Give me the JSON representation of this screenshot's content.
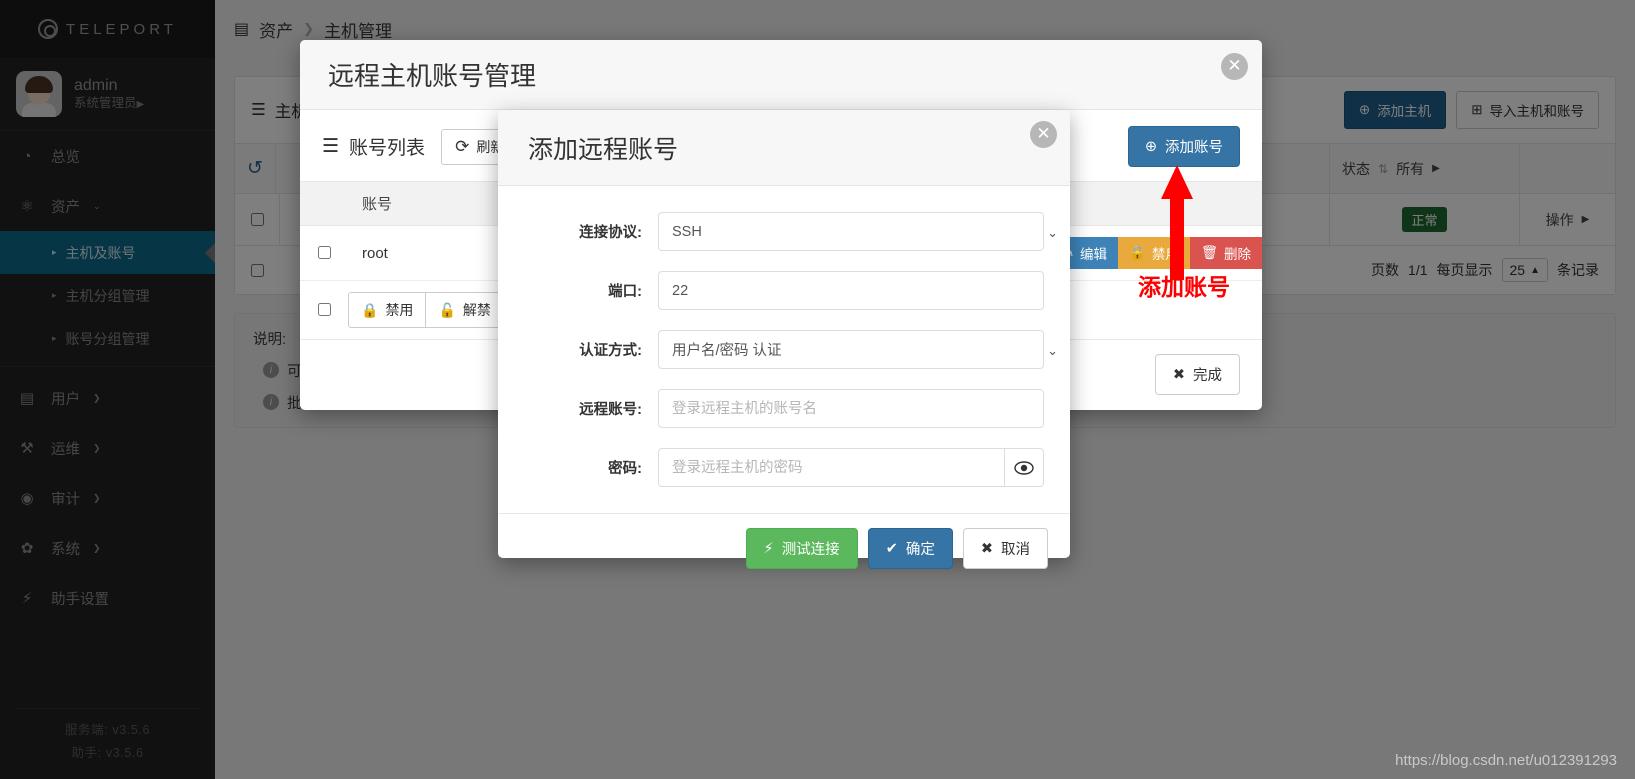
{
  "sidebar": {
    "brand": "TELEPORT",
    "user": {
      "name": "admin",
      "role": "系统管理员",
      "role_caret": "▶"
    },
    "items": [
      {
        "label": "总览",
        "icon": "dashboard-icon",
        "glyph": "◔"
      },
      {
        "label": "资产",
        "icon": "assets-icon",
        "glyph": "⚛",
        "caret": "⌄"
      },
      {
        "label": "用户",
        "icon": "user-icon",
        "glyph": "▤",
        "caret": "❯"
      },
      {
        "label": "运维",
        "icon": "wrench-icon",
        "glyph": "⚒",
        "caret": "❯"
      },
      {
        "label": "审计",
        "icon": "eye-icon",
        "glyph": "◉",
        "caret": "❯"
      },
      {
        "label": "系统",
        "icon": "gear-icon",
        "glyph": "✿",
        "caret": "❯"
      },
      {
        "label": "助手设置",
        "icon": "bolt-icon",
        "glyph": "⚡"
      }
    ],
    "sub_items": [
      {
        "label": "主机及账号",
        "active": true
      },
      {
        "label": "主机分组管理",
        "active": false
      },
      {
        "label": "账号分组管理",
        "active": false
      }
    ],
    "versions": [
      "服务端: v3.5.6",
      "助手: v3.5.6"
    ]
  },
  "breadcrumb": {
    "icon": "server-icon",
    "root": "资产",
    "sep": "❯",
    "current": "主机管理"
  },
  "host_panel": {
    "title": "主机列表",
    "add_host": "添加主机",
    "import": "导入主机和账号",
    "refresh_icon": "refresh-icon",
    "columns": {
      "status": "状态",
      "status_filter": "所有",
      "filter_caret": "▶",
      "sort_glyph": "⇅"
    },
    "row": {
      "status_badge": "正常",
      "action": "操作",
      "action_caret": "▶"
    },
    "pager": {
      "pages_label": "页数",
      "pages_value": "1/1",
      "per_page_label": "每页显示",
      "per_page_value": "25",
      "per_page_caret": "▲",
      "records_label": "条记录"
    }
  },
  "note": {
    "title": "说明:",
    "lines": [
      "可以通过表格标题栏进行搜索",
      "批量导入主机和账号需要上传"
    ]
  },
  "outer_modal": {
    "title": "远程主机账号管理",
    "close_icon": "close-icon",
    "list_title": "账号列表",
    "list_icon": "list-icon",
    "refresh_label": "刷新",
    "refresh_icon": "refresh-icon",
    "add_account": "添加账号",
    "add_icon": "plus-circle-icon",
    "table": {
      "columns": [
        "",
        "账号"
      ],
      "rows": [
        {
          "checked": false,
          "account": "root"
        }
      ]
    },
    "row_actions": [
      {
        "label": "编辑",
        "icon": "pencil-icon",
        "style": "act-edit"
      },
      {
        "label": "禁用",
        "icon": "lock-icon",
        "style": "act-disable"
      },
      {
        "label": "删除",
        "icon": "trash-icon",
        "style": "act-delete"
      }
    ],
    "bulk_actions": [
      {
        "label": "禁用",
        "icon": "lock-closed-icon"
      },
      {
        "label": "解禁",
        "icon": "lock-open-icon"
      }
    ],
    "done_label": "完成",
    "done_icon": "x-icon"
  },
  "inner_modal": {
    "title": "添加远程账号",
    "close_icon": "close-icon",
    "fields": [
      {
        "label": "连接协议:",
        "type": "select",
        "value": "SSH",
        "name": "protocol"
      },
      {
        "label": "端口:",
        "type": "text",
        "value": "22",
        "placeholder": "",
        "name": "port"
      },
      {
        "label": "认证方式:",
        "type": "select",
        "value": "用户名/密码 认证",
        "name": "auth-method"
      },
      {
        "label": "远程账号:",
        "type": "text",
        "value": "",
        "placeholder": "登录远程主机的账号名",
        "name": "remote-account"
      },
      {
        "label": "密码:",
        "type": "password",
        "value": "",
        "placeholder": "登录远程主机的密码",
        "name": "password"
      }
    ],
    "eye_icon": "eye-icon",
    "buttons": [
      {
        "label": "测试连接",
        "icon": "bolt-icon",
        "glyph": "⚡",
        "style": "btn-test"
      },
      {
        "label": "确定",
        "icon": "check-icon",
        "glyph": "✔",
        "style": "btn-ok"
      },
      {
        "label": "取消",
        "icon": "x-icon",
        "glyph": "✖",
        "style": "btn-cancel"
      }
    ]
  },
  "annotation": {
    "text": "添加账号",
    "color": "#ff0000",
    "arrow": "up-arrow"
  },
  "watermark": "https://blog.csdn.net/u012391293",
  "colors": {
    "sidebar_bg": "#232323",
    "active_nav": "#0c6a8c",
    "primary_blue": "#3574a5",
    "dark_blue": "#1f618d",
    "green": "#5cb85c",
    "status_green": "#1f6b33",
    "orange": "#e9a93d",
    "red": "#d9534f",
    "annotation_red": "#ff0000"
  }
}
